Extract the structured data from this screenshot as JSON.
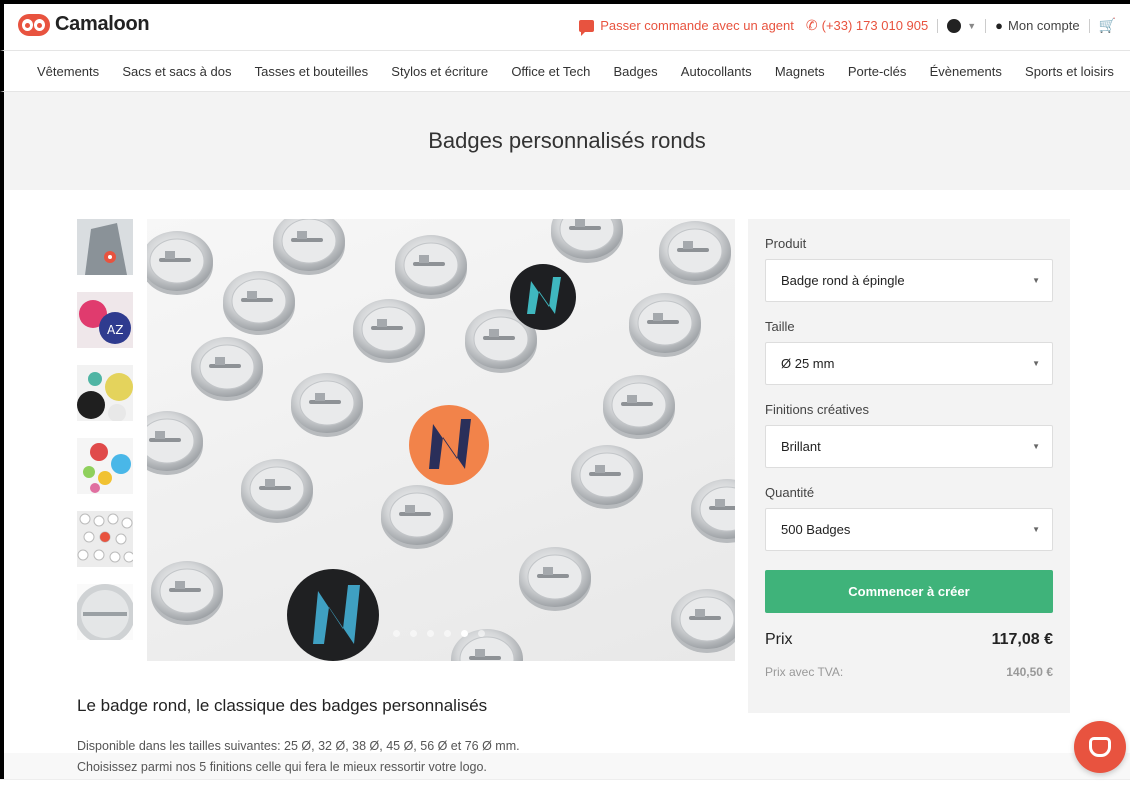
{
  "brand": {
    "name": "Camaloon",
    "accent": "#e8533f",
    "cta_color": "#3fb37a"
  },
  "topbar": {
    "agent_link": "Passer commande avec un agent",
    "phone": "(+33) 173 010 905",
    "account": "Mon compte",
    "icons": [
      "chat-icon",
      "phone-icon",
      "globe-icon",
      "user-icon",
      "cart-icon"
    ]
  },
  "nav": {
    "items": [
      "Vêtements",
      "Sacs et sacs à dos",
      "Tasses et bouteilles",
      "Stylos et écriture",
      "Office et Tech",
      "Badges",
      "Autocollants",
      "Magnets",
      "Porte-clés",
      "Évènements",
      "Sports et loisirs"
    ]
  },
  "page": {
    "title": "Badges personnalisés ronds"
  },
  "gallery": {
    "thumbnail_count": 6,
    "slide_count": 6,
    "active_slide": 5
  },
  "configurator": {
    "product": {
      "label": "Produit",
      "value": "Badge rond à épingle"
    },
    "size": {
      "label": "Taille",
      "value": "Ø 25 mm"
    },
    "finish": {
      "label": "Finitions créatives",
      "value": "Brillant"
    },
    "quantity": {
      "label": "Quantité",
      "value": "500 Badges"
    },
    "cta": "Commencer à créer",
    "price_label": "Prix",
    "price": "117,08 €",
    "vat_label": "Prix avec TVA:",
    "vat_price": "140,50 €"
  },
  "description": {
    "title": "Le badge rond, le classique des badges personnalisés",
    "line1": "Disponible dans les tailles suivantes: 25 Ø, 32 Ø, 38 Ø, 45 Ø, 56 Ø et 76 Ø mm.",
    "line2": "Choisissez parmi nos 5 finitions celle qui fera le mieux ressortir votre logo."
  }
}
